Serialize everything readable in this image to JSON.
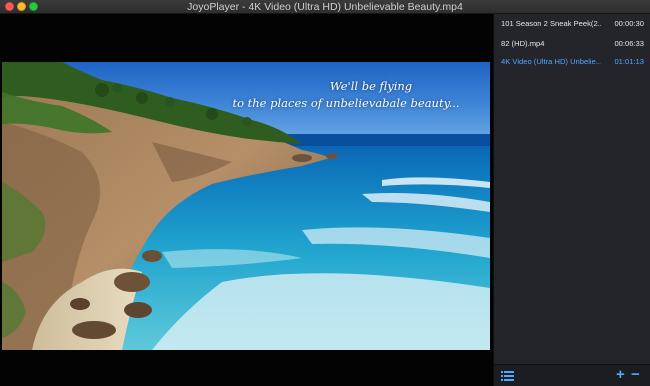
{
  "window": {
    "title": "JoyoPlayer - 4K Video (Ultra HD) Unbelievable Beauty.mp4"
  },
  "video": {
    "subtitle_line1": "We'll be flying",
    "subtitle_line2": "to the places of unbelievabale beauty..."
  },
  "playlist": {
    "items": [
      {
        "name": "101 Season 2 Sneak Peek(2...",
        "duration": "00:00:30",
        "active": false
      },
      {
        "name": "82 (HD).mp4",
        "duration": "00:06:33",
        "active": false
      },
      {
        "name": "4K Video (Ultra HD) Unbelie...",
        "duration": "01:01:13",
        "active": true
      }
    ],
    "footer": {
      "list_icon": "list-icon",
      "add_label": "+",
      "remove_label": "−"
    }
  },
  "colors": {
    "accent": "#4fa8ff",
    "panel_bg": "#23252a",
    "video_bg": "#030303"
  }
}
